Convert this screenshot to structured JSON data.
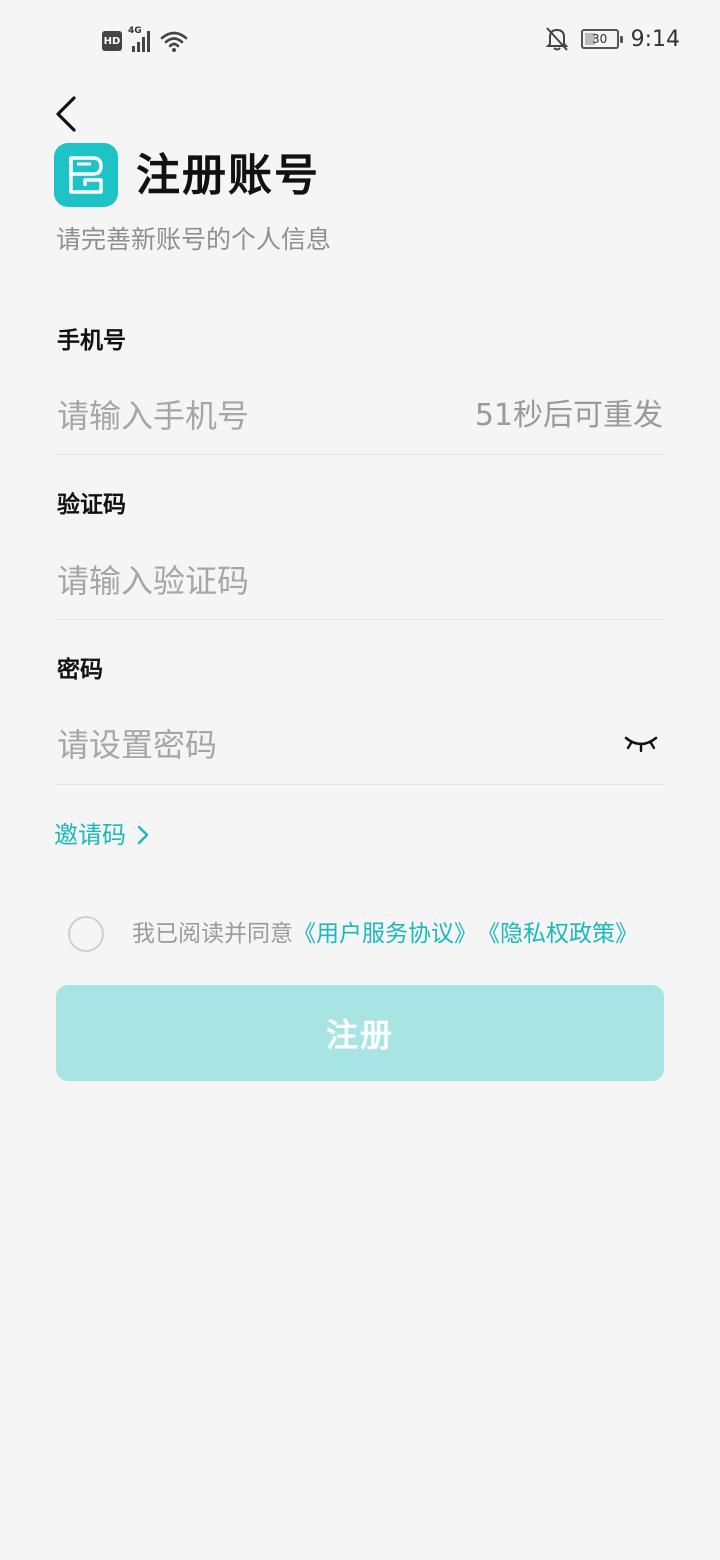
{
  "status_bar": {
    "hd_label": "HD",
    "network_label": "4G",
    "battery_level": "30",
    "time": "9:14",
    "icons": [
      "hd-icon",
      "signal-icon",
      "wifi-icon",
      "bell-off-icon",
      "battery-icon"
    ]
  },
  "header": {
    "title": "注册账号",
    "subtitle": "请完善新账号的个人信息"
  },
  "form": {
    "phone": {
      "label": "手机号",
      "value": "",
      "placeholder": "请输入手机号",
      "resend_text": "51秒后可重发"
    },
    "code": {
      "label": "验证码",
      "value": "",
      "placeholder": "请输入验证码"
    },
    "password": {
      "label": "密码",
      "value": "",
      "placeholder": "请设置密码"
    },
    "invite_label": "邀请码"
  },
  "agreement": {
    "checked": false,
    "prefix": "我已阅读并同意",
    "user_agreement": "《用户服务协议》",
    "privacy_policy": "《隐私权政策》"
  },
  "register_button": {
    "label": "注册"
  },
  "colors": {
    "accent": "#1ab8bf",
    "logo": "#1ec3c7",
    "button_disabled": "#a9e4e4",
    "background": "#f5f5f5"
  }
}
